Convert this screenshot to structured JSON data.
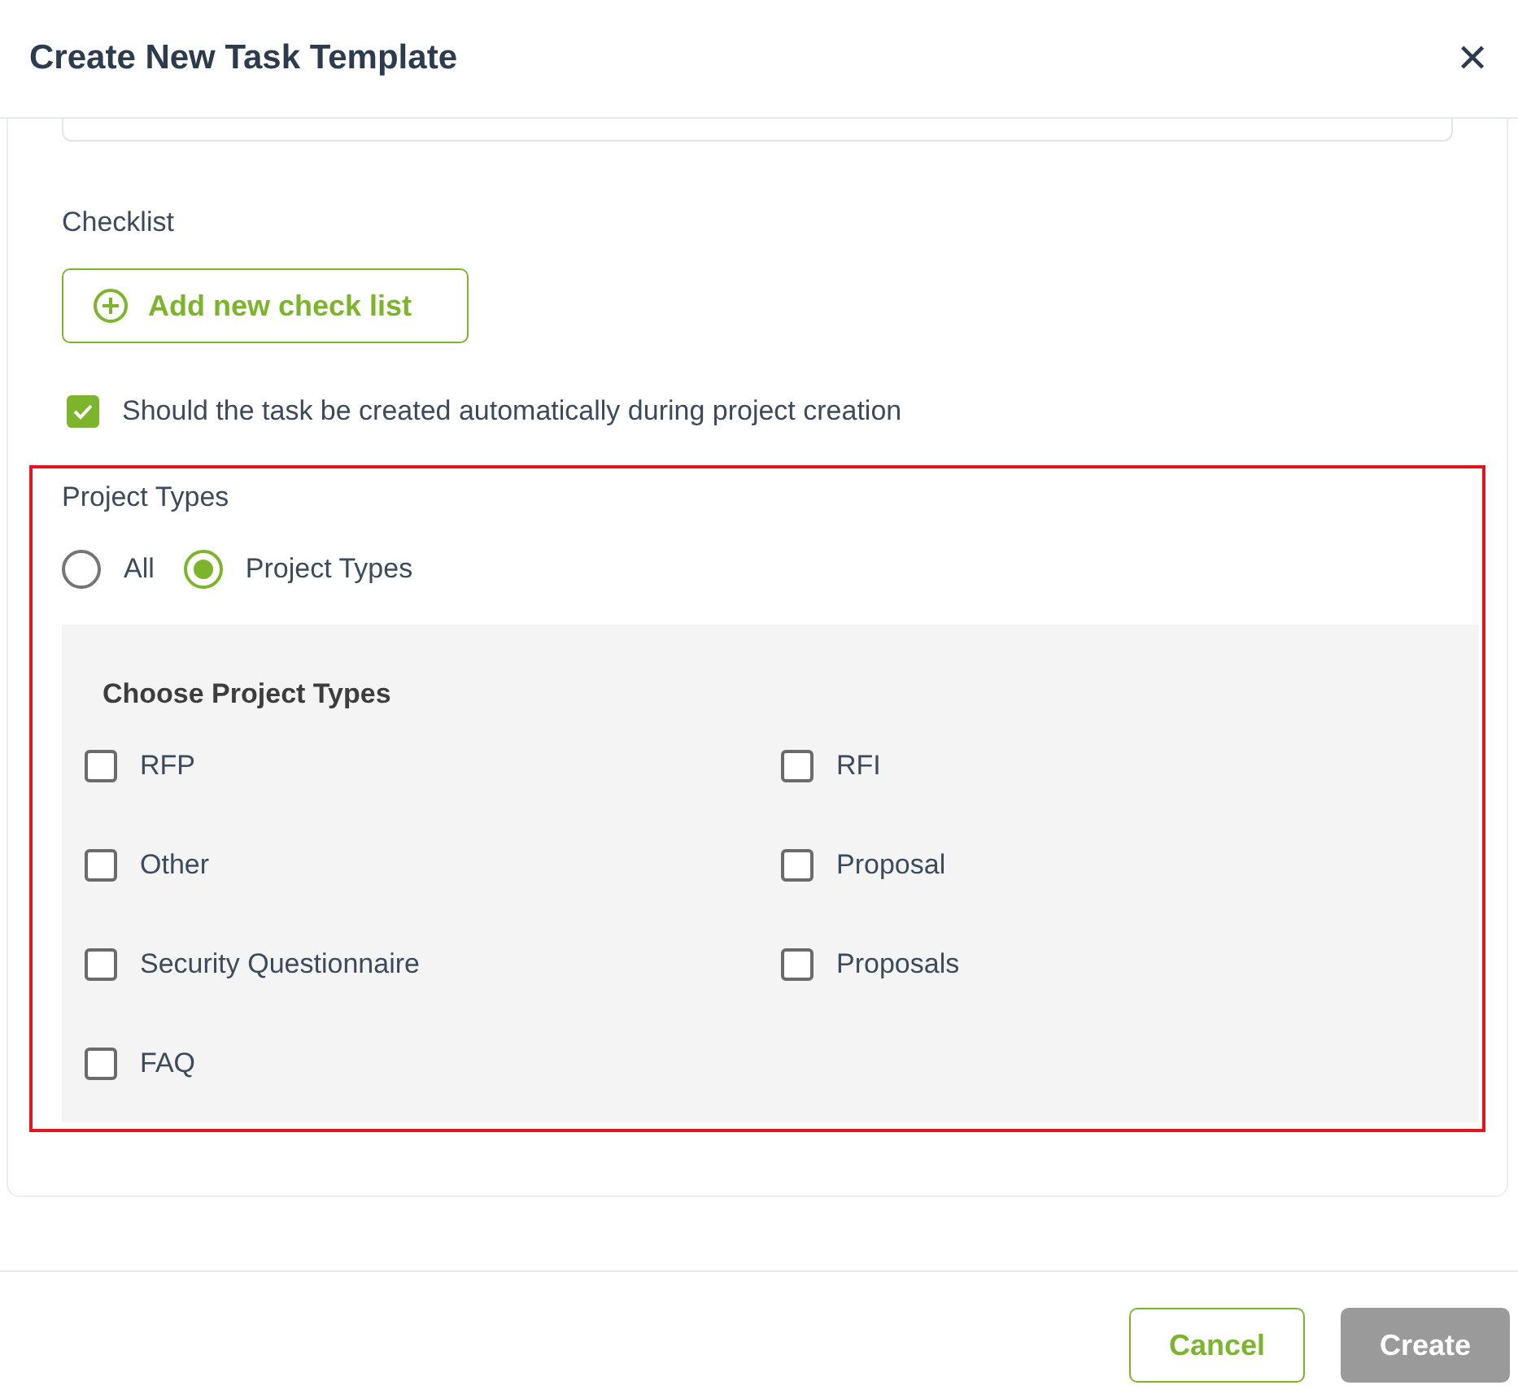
{
  "dialog": {
    "title": "Create New Task Template",
    "close": "✕"
  },
  "checklist": {
    "label": "Checklist",
    "add_button": "Add new check list"
  },
  "auto_create": {
    "label": "Should the task be created automatically during project creation",
    "checked": true
  },
  "project_types": {
    "label": "Project Types",
    "highlighted": true,
    "options": [
      {
        "label": "All",
        "selected": false
      },
      {
        "label": "Project Types",
        "selected": true
      }
    ],
    "panel_title": "Choose Project Types",
    "items": [
      {
        "label": "RFP",
        "checked": false
      },
      {
        "label": "RFI",
        "checked": false
      },
      {
        "label": "Other",
        "checked": false
      },
      {
        "label": "Proposal",
        "checked": false
      },
      {
        "label": "Security Questionnaire",
        "checked": false
      },
      {
        "label": "Proposals",
        "checked": false
      },
      {
        "label": "FAQ",
        "checked": false
      }
    ]
  },
  "buttons": [
    {
      "label": "Cancel",
      "kind": "secondary",
      "disabled": false
    },
    {
      "label": "Create",
      "kind": "primary",
      "disabled": true
    }
  ]
}
